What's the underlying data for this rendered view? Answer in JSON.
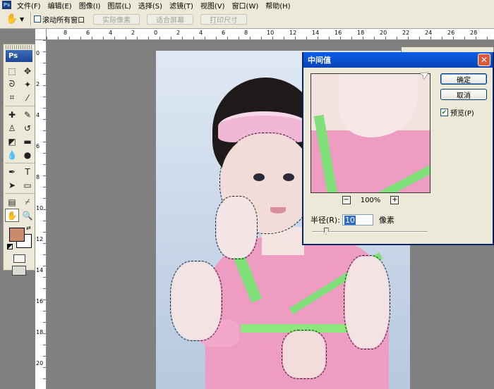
{
  "app": {
    "icon_label": "Ps"
  },
  "menu": [
    {
      "label": "文件(F)"
    },
    {
      "label": "编辑(E)"
    },
    {
      "label": "图像(I)"
    },
    {
      "label": "图层(L)"
    },
    {
      "label": "选择(S)"
    },
    {
      "label": "滤镜(T)"
    },
    {
      "label": "视图(V)"
    },
    {
      "label": "窗口(W)"
    },
    {
      "label": "帮助(H)"
    }
  ],
  "options": {
    "scroll_all_label": "滚动所有窗口",
    "scroll_all_checked": false,
    "actual_pixels_label": "实际像素",
    "fit_screen_label": "适合屏幕",
    "print_size_label": "打印尺寸"
  },
  "rulers": {
    "top_ticks": [
      "8",
      "6",
      "4",
      "2",
      "0",
      "2",
      "4",
      "6",
      "8",
      "10",
      "12",
      "14",
      "16",
      "18",
      "20",
      "22",
      "24",
      "26",
      "28"
    ],
    "left_ticks": [
      "0",
      "2",
      "4",
      "6",
      "8",
      "10",
      "12",
      "14",
      "16",
      "18",
      "20"
    ]
  },
  "toolbox": {
    "logo": "Ps",
    "tools": [
      {
        "name": "marquee-tool",
        "glyph": "⬚",
        "active": false
      },
      {
        "name": "move-tool",
        "glyph": "✥",
        "active": false
      },
      {
        "name": "lasso-tool",
        "glyph": "ᘐ",
        "active": false
      },
      {
        "name": "magic-wand-tool",
        "glyph": "✦",
        "active": false
      },
      {
        "name": "crop-tool",
        "glyph": "⌗",
        "active": false
      },
      {
        "name": "slice-tool",
        "glyph": "⁄",
        "active": false
      },
      {
        "name": "healing-brush-tool",
        "glyph": "✚",
        "active": false
      },
      {
        "name": "brush-tool",
        "glyph": "✎",
        "active": false
      },
      {
        "name": "clone-stamp-tool",
        "glyph": "♙",
        "active": false
      },
      {
        "name": "history-brush-tool",
        "glyph": "↺",
        "active": false
      },
      {
        "name": "eraser-tool",
        "glyph": "◩",
        "active": false
      },
      {
        "name": "gradient-tool",
        "glyph": "▬",
        "active": false
      },
      {
        "name": "blur-tool",
        "glyph": "💧",
        "active": false
      },
      {
        "name": "dodge-tool",
        "glyph": "●",
        "active": false
      },
      {
        "name": "pen-tool",
        "glyph": "✒",
        "active": false
      },
      {
        "name": "type-tool",
        "glyph": "T",
        "active": false
      },
      {
        "name": "path-selection-tool",
        "glyph": "➤",
        "active": false
      },
      {
        "name": "shape-tool",
        "glyph": "▭",
        "active": false
      },
      {
        "name": "notes-tool",
        "glyph": "▤",
        "active": false
      },
      {
        "name": "eyedropper-tool",
        "glyph": "⌿",
        "active": false
      },
      {
        "name": "hand-tool",
        "glyph": "✋",
        "active": true
      },
      {
        "name": "zoom-tool",
        "glyph": "🔍",
        "active": false
      }
    ],
    "foreground_color": "#c98b6a",
    "background_color": "#ffffff"
  },
  "dialog": {
    "title": "中间值",
    "ok_label": "确定",
    "cancel_label": "取消",
    "preview_label": "预览(P)",
    "preview_checked": true,
    "zoom_minus": "−",
    "zoom_value": "100%",
    "zoom_plus": "+",
    "radius_label": "半径(R):",
    "radius_value": "10",
    "radius_unit": "像素",
    "slider_fraction": 0.12
  }
}
